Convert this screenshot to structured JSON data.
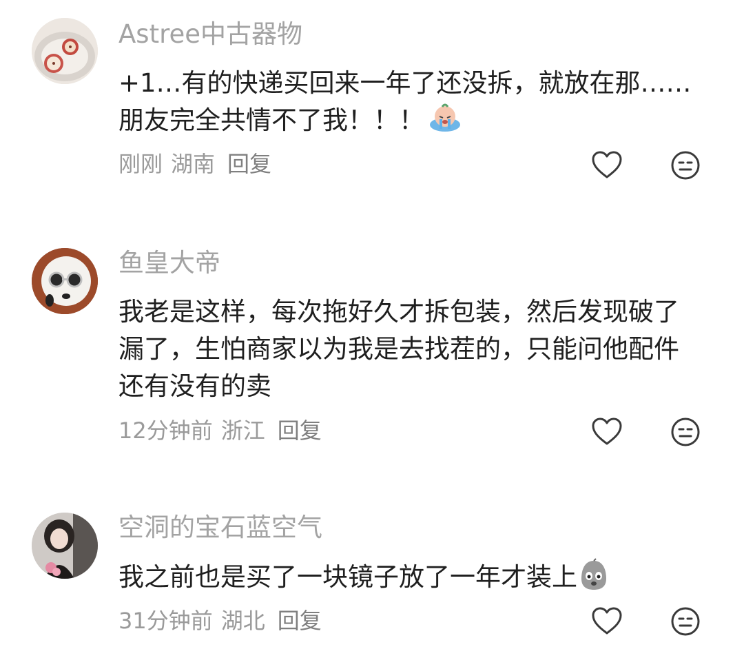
{
  "comments": [
    {
      "username": "Astree中古器物",
      "content": "+1…有的快递买回来一年了还没拆，就放在那……朋友完全共情不了我！！！",
      "content_emoji": "crying-emoji",
      "time": "刚刚",
      "location": "湖南",
      "reply_label": "回复",
      "avatar_icon": "apple-plate-avatar"
    },
    {
      "username": "鱼皇大帝",
      "content": "我老是这样，每次拖好久才拆包装，然后发现破了漏了，生怕商家以为我是去找茬的，只能问他配件还有没有的卖",
      "time": "12分钟前",
      "location": "浙江",
      "reply_label": "回复",
      "avatar_icon": "dog-sunglasses-avatar"
    },
    {
      "username": "空洞的宝石蓝空气",
      "content": "我之前也是买了一块镜子放了一年才装上",
      "content_emoji": "speechless-bird-emoji",
      "time": "31分钟前",
      "location": "湖北",
      "reply_label": "回复",
      "avatar_icon": "girl-portrait-avatar"
    }
  ],
  "icons": {
    "like": "heart-outline-icon",
    "dislike": "meh-face-icon"
  },
  "colors": {
    "username": "#a3a3a3",
    "content": "#1f1f1f",
    "meta": "#9a9a9a",
    "icon": "#3a3a3a"
  }
}
